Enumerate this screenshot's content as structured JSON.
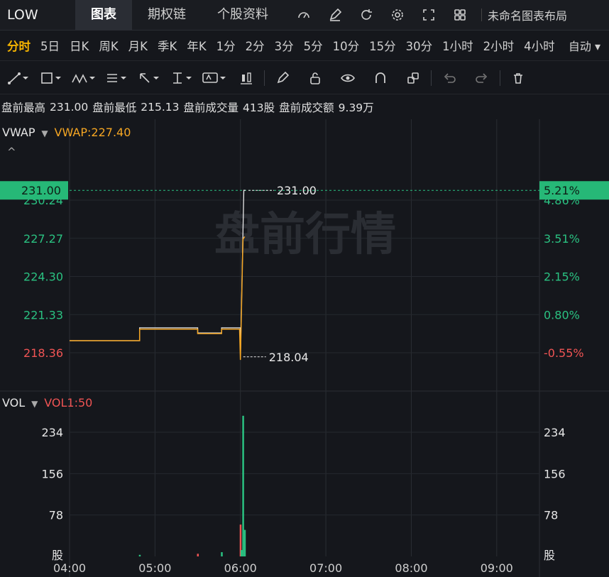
{
  "top": {
    "ticker": "LOW",
    "tabs": [
      "图表",
      "期权链",
      "个股资料"
    ],
    "layout_name": "未命名图表布局"
  },
  "intervals": {
    "items": [
      "分时",
      "5日",
      "日K",
      "周K",
      "月K",
      "季K",
      "年K",
      "1分",
      "2分",
      "3分",
      "5分",
      "10分",
      "15分",
      "30分",
      "1小时",
      "2小时",
      "4小时"
    ],
    "active": "分时",
    "mode": "自动"
  },
  "stats": {
    "high_label": "盘前最高",
    "high": "231.00",
    "low_label": "盘前最低",
    "low": "215.13",
    "vol_label": "盘前成交量",
    "vol": "413股",
    "amt_label": "盘前成交额",
    "amt": "9.39万"
  },
  "chart_data": {
    "type": "line",
    "watermark": "盘前行情",
    "indicator": "VWAP",
    "indicator_value_label": "VWAP:227.40",
    "y_ticks": [
      230.24,
      227.27,
      224.3,
      221.33,
      218.36
    ],
    "y_tick_labels": [
      "230.24",
      "227.27",
      "224.30",
      "221.33",
      "218.36"
    ],
    "pct_ticks": [
      "4.86%",
      "3.51%",
      "2.15%",
      "0.80%",
      "-0.55%"
    ],
    "current_price": "231.00",
    "current_pct": "5.21%",
    "max_label": "231.00",
    "min_label": "218.04",
    "x_ticks": [
      "04:00",
      "05:00",
      "06:00",
      "07:00",
      "08:00",
      "09:00"
    ],
    "price_series": [
      {
        "t": 4.0,
        "p": 219.3
      },
      {
        "t": 4.82,
        "p": 219.3
      },
      {
        "t": 4.82,
        "p": 220.3
      },
      {
        "t": 5.5,
        "p": 220.3
      },
      {
        "t": 5.5,
        "p": 219.9
      },
      {
        "t": 5.78,
        "p": 219.9
      },
      {
        "t": 5.78,
        "p": 220.3
      },
      {
        "t": 6.0,
        "p": 220.3
      },
      {
        "t": 6.0,
        "p": 218.04
      },
      {
        "t": 6.04,
        "p": 231.0
      },
      {
        "t": 6.06,
        "p": 231.0
      }
    ],
    "vwap_series": [
      {
        "t": 4.0,
        "p": 219.3
      },
      {
        "t": 4.82,
        "p": 219.3
      },
      {
        "t": 4.82,
        "p": 220.2
      },
      {
        "t": 5.5,
        "p": 220.2
      },
      {
        "t": 5.5,
        "p": 219.85
      },
      {
        "t": 5.78,
        "p": 219.85
      },
      {
        "t": 5.78,
        "p": 220.2
      },
      {
        "t": 5.99,
        "p": 220.2
      },
      {
        "t": 6.0,
        "p": 217.8
      },
      {
        "t": 6.03,
        "p": 227.2
      },
      {
        "t": 6.05,
        "p": 227.4
      }
    ],
    "volume": {
      "indicator": "VOL",
      "indicator_label": "VOL1:50",
      "y_ticks": [
        "234",
        "156",
        "78"
      ],
      "unit": "股",
      "bars": [
        {
          "t": 4.82,
          "v": 3,
          "dir": "up"
        },
        {
          "t": 5.5,
          "v": 5,
          "dir": "down"
        },
        {
          "t": 5.78,
          "v": 8,
          "dir": "up"
        },
        {
          "t": 6.0,
          "v": 60,
          "dir": "down"
        },
        {
          "t": 6.01,
          "v": 12,
          "dir": "up"
        },
        {
          "t": 6.03,
          "v": 265,
          "dir": "up"
        },
        {
          "t": 6.05,
          "v": 50,
          "dir": "up"
        }
      ]
    },
    "colors": {
      "price": "#e8e8e8",
      "vwap": "#f5a623",
      "up": "#2ac181",
      "down": "#f05454",
      "accent": "#26b877"
    }
  }
}
